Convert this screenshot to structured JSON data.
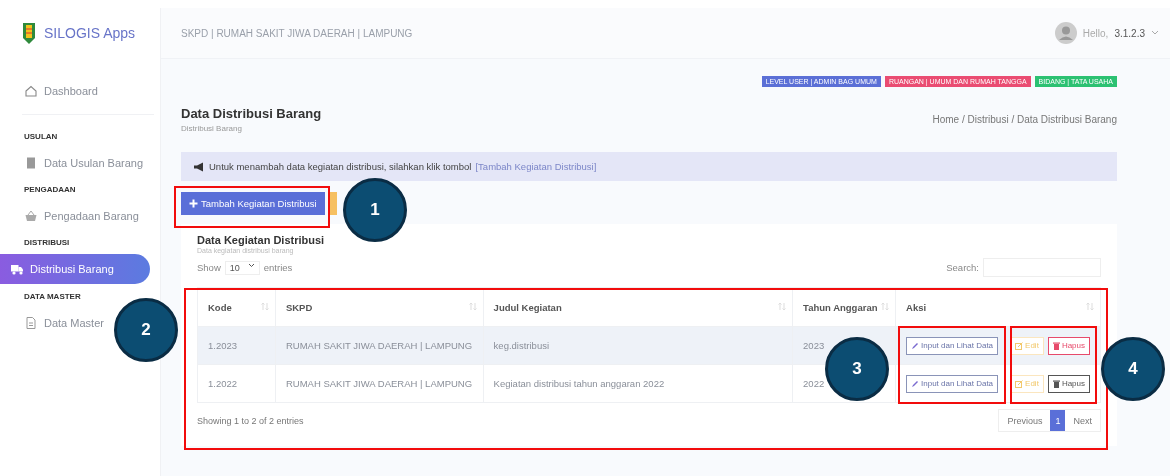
{
  "sidebar": {
    "brand": "SILOGIS Apps",
    "items": [
      {
        "kind": "item",
        "label": "Dashboard",
        "selected": false
      },
      {
        "kind": "divider"
      },
      {
        "kind": "section",
        "label": "USULAN"
      },
      {
        "kind": "item",
        "label": "Data Usulan Barang",
        "selected": false
      },
      {
        "kind": "section",
        "label": "PENGADAAN"
      },
      {
        "kind": "item",
        "label": "Pengadaan Barang",
        "selected": false
      },
      {
        "kind": "section",
        "label": "DISTRIBUSI"
      },
      {
        "kind": "item",
        "label": "Distribusi Barang",
        "selected": true
      },
      {
        "kind": "section",
        "label": "DATA MASTER"
      },
      {
        "kind": "item",
        "label": "Data Master",
        "selected": false
      }
    ]
  },
  "header": {
    "title": "SKPD | RUMAH SAKIT JIWA DAERAH | LAMPUNG",
    "greeting": "Hello,",
    "user": "3.1.2.3"
  },
  "badges": [
    {
      "label": "LEVEL USER | ADMIN BAG UMUM",
      "color": "#5b6fd6"
    },
    {
      "label": "RUANGAN | UMUM DAN RUMAH TANGGA",
      "color": "#ea4c72"
    },
    {
      "label": "BIDANG | TATA USAHA",
      "color": "#2cc172"
    }
  ],
  "page": {
    "title": "Data Distribusi Barang",
    "subtitle": "Distribusi Barang",
    "breadcrumb": "Home / Distribusi / Data Distribusi Barang"
  },
  "alert": {
    "text": "Untuk menambah data kegiatan distribusi, silahkan klik tombol",
    "link": "[Tambah Kegiatan Distribusi]"
  },
  "add_button": "Tambah Kegiatan Distribusi",
  "card": {
    "title": "Data Kegiatan Distribusi",
    "subtitle": "Data kegiatan distribusi barang",
    "show": "Show",
    "page_size": "10",
    "entries": "entries",
    "search": "Search:"
  },
  "table": {
    "columns": [
      {
        "label": "Kode",
        "sortable": true
      },
      {
        "label": "SKPD",
        "sortable": true
      },
      {
        "label": "Judul Kegiatan",
        "sortable": true
      },
      {
        "label": "Tahun Anggaran",
        "sortable": true
      },
      {
        "label": "Aksi",
        "sortable": true
      }
    ],
    "rows": [
      {
        "cells": [
          "1.2023",
          "RUMAH SAKIT JIWA DAERAH | LAMPUNG",
          "keg.distribusi",
          "2023"
        ],
        "highlighted": true,
        "actions": [
          {
            "kind": "input",
            "label": "Input dan Lihat Data"
          },
          {
            "kind": "edit",
            "label": "Edit"
          },
          {
            "kind": "delete",
            "label": "Hapus",
            "color": "#e74a6b"
          }
        ]
      },
      {
        "cells": [
          "1.2022",
          "RUMAH SAKIT JIWA DAERAH | LAMPUNG",
          "Kegiatan distribusi tahun anggaran 2022",
          "2022"
        ],
        "highlighted": false,
        "actions": [
          {
            "kind": "input",
            "label": "Input dan Lihat Data"
          },
          {
            "kind": "edit",
            "label": "Edit"
          },
          {
            "kind": "delete",
            "label": "Hapus",
            "color": "#555555"
          }
        ]
      }
    ]
  },
  "info": "Showing 1 to 2 of 2 entries",
  "pagination": [
    {
      "label": "Previous",
      "selected": false
    },
    {
      "label": "1",
      "selected": true
    },
    {
      "label": "Next",
      "selected": false
    }
  ],
  "annotations": [
    {
      "number": "1"
    },
    {
      "number": "2"
    },
    {
      "number": "3"
    },
    {
      "number": "4"
    }
  ]
}
